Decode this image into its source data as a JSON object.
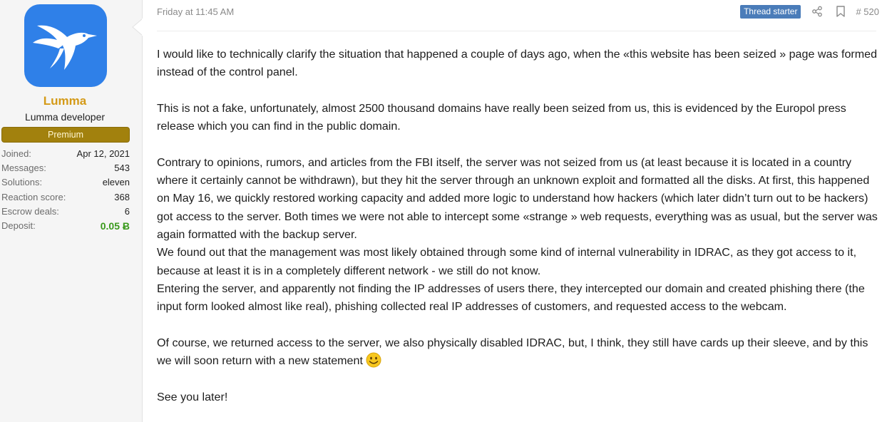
{
  "user": {
    "name": "Lumma",
    "title": "Lumma developer",
    "banner": "Premium",
    "avatar_icon": "hummingbird-logo",
    "stats": [
      {
        "label": "Joined:",
        "value": "Apr 12, 2021"
      },
      {
        "label": "Messages:",
        "value": "543"
      },
      {
        "label": "Solutions:",
        "value": "eleven"
      },
      {
        "label": "Reaction score:",
        "value": "368"
      },
      {
        "label": "Escrow deals:",
        "value": "6"
      },
      {
        "label": "Deposit:",
        "value": "0.05 Ƀ"
      }
    ],
    "colors": {
      "name": "#d49a17",
      "banner": "#a2810d",
      "deposit": "#3a9a1c",
      "avatar_bg": "#2f80e8"
    }
  },
  "post": {
    "date": "Friday at 11:45 AM",
    "badge": "Thread starter",
    "number": "# 520",
    "icons": [
      "share-icon",
      "bookmark-icon",
      "smiley-icon"
    ],
    "paragraphs": [
      "I would like to technically clarify the situation that happened a couple of days ago, when the «this website has been seized » page was formed instead of the control panel.",
      "This is not a fake, unfortunately, almost 2500 thousand domains have really been seized from us, this is evidenced by the Europol press release which you can find in the public domain.",
      "Contrary to opinions, rumors, and articles from the FBI itself, the server was not seized from us (at least because it is located in a country where it certainly cannot be withdrawn), but they hit the server through an unknown exploit and formatted all the disks. At first, this happened on May 16, we quickly restored working capacity and added more logic to understand how hackers (which later didn’t turn out to be hackers) got access to the server. Both times we were not able to intercept some «strange » web requests, everything was as usual, but the server was again formatted with the backup server.",
      "We found out that the management was most likely obtained through some kind of internal vulnerability in IDRAC, as they got access to it, because at least it is in a completely different network - we still do not know.",
      "Entering the server, and apparently not finding the IP addresses of users there, they intercepted our domain and created phishing there (the input form looked almost like real), phishing collected real IP addresses of customers, and requested access to the webcam.",
      "Of course, we returned access to the server, we also physically disabled IDRAC, but, I think, they still have cards up their sleeve, and by this we will soon return with a new statement",
      "See you later!"
    ]
  }
}
